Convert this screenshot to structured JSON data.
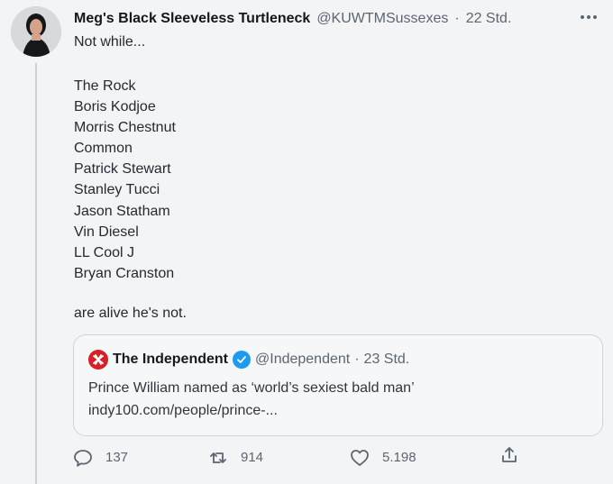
{
  "tweet": {
    "author_name": "Meg's Black Sleeveless Turtleneck",
    "author_handle": "@KUWTMSussexes",
    "separator": "·",
    "time": "22 Std.",
    "intro": "Not while...",
    "names": [
      "The Rock",
      "Boris Kodjoe",
      "Morris Chestnut",
      "Common",
      "Patrick Stewart",
      "Stanley Tucci",
      "Jason Statham",
      "Vin Diesel",
      "LL Cool J",
      "Bryan Cranston"
    ],
    "closing": "are alive he's not."
  },
  "quote": {
    "name": "The Independent",
    "handle": "@Independent",
    "separator": "·",
    "time": "23 Std.",
    "line1": "Prince William named as ‘world’s sexiest bald man’",
    "line2": "indy100.com/people/prince-..."
  },
  "actions": {
    "replies": "137",
    "retweets": "914",
    "likes": "5.198"
  },
  "colors": {
    "background": "#f3f4f6",
    "text": "#242a30",
    "secondary": "#5b6670",
    "brand_red": "#d71f26",
    "verified_blue": "#1d9bf0"
  }
}
